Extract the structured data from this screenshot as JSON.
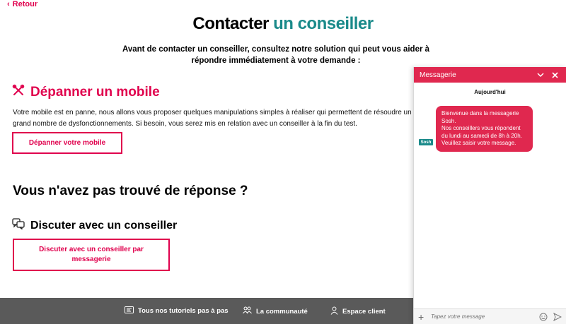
{
  "nav": {
    "back_label": "Retour"
  },
  "header": {
    "title_part1": "Contacter",
    "title_part2": "un conseiller",
    "intro": "Avant de contacter un conseiller, consultez notre solution qui peut vous aider à répondre immédiatement à votre demande :"
  },
  "repair": {
    "title": "Dépanner un mobile",
    "text": "Votre mobile est en panne, nous allons vous proposer quelques manipulations simples à réaliser qui permettent de résoudre un grand nombre de dysfonctionnements. Si besoin, vous serez mis en relation avec un conseiller à la fin du test.",
    "button_label": "Dépanner votre mobile"
  },
  "no_answer": {
    "title": "Vous n'avez pas trouvé de réponse ?"
  },
  "chat_section": {
    "title": "Discuter avec un conseiller",
    "button_label": "Discuter avec un conseiller par messagerie"
  },
  "footer": {
    "items": [
      {
        "label": "Tous nos tutoriels pas à pas",
        "icon": "tutorial-icon"
      },
      {
        "label": "La communauté",
        "icon": "community-icon"
      },
      {
        "label": "Espace client",
        "icon": "user-icon"
      }
    ]
  },
  "chat_widget": {
    "title": "Messagerie",
    "date": "Aujourd'hui",
    "avatar_label": "Sosh",
    "message": "Bienvenue dans la messagerie Sosh.\nNos conseillers vous répondent du lundi au samedi de 8h à 20h.\nVeuillez saisir votre message.",
    "input_placeholder": "Tapez votre message"
  },
  "colors": {
    "accent": "#e0004d",
    "teal": "#1a8a8a",
    "footer_bg": "#5a5a5a",
    "chat_header": "#e0284f"
  }
}
